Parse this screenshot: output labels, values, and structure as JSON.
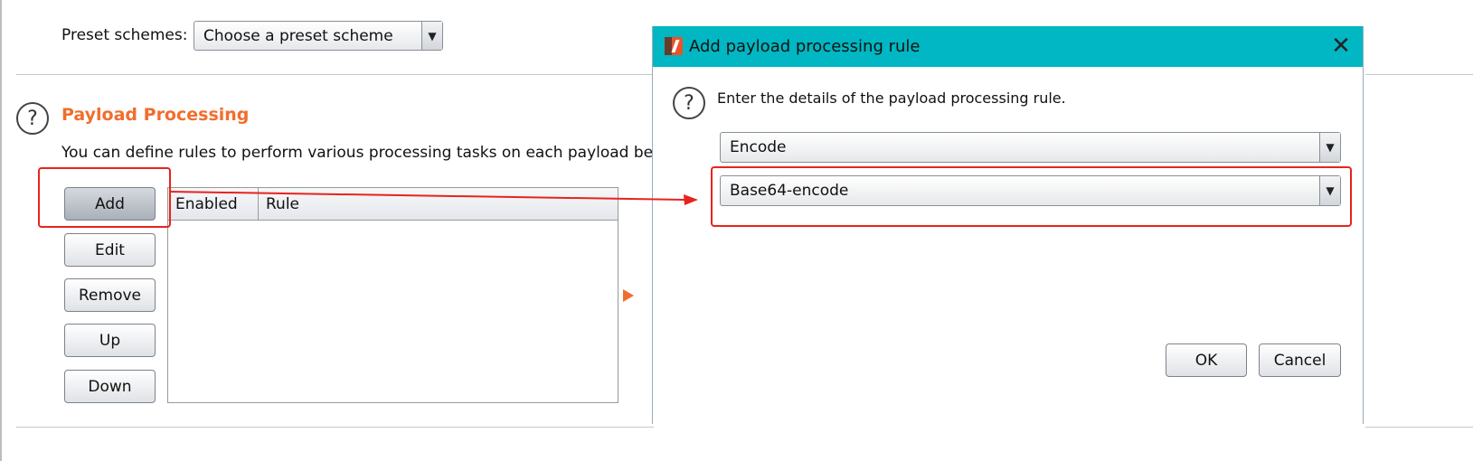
{
  "preset": {
    "label": "Preset schemes:",
    "selected": "Choose a preset scheme"
  },
  "payload_processing": {
    "title": "Payload Processing",
    "description": "You can define rules to perform various processing tasks on each payload before it",
    "buttons": {
      "add": "Add",
      "edit": "Edit",
      "remove": "Remove",
      "up": "Up",
      "down": "Down"
    },
    "table": {
      "columns": [
        "Enabled",
        "Rule"
      ],
      "rows": []
    }
  },
  "dialog": {
    "title": "Add payload processing rule",
    "instruction": "Enter the details of the payload processing rule.",
    "rule_type_selected": "Encode",
    "encoding_selected": "Base64-encode",
    "ok_label": "OK",
    "cancel_label": "Cancel"
  },
  "colors": {
    "accent_orange": "#f26d2d",
    "titlebar_teal": "#00b7c3",
    "annotation_red": "#e8231e"
  },
  "icons": {
    "help": "help-circle-icon",
    "dropdown": "chevron-down-icon",
    "close": "close-icon",
    "app": "burp-suite-icon",
    "expand": "triangle-right-icon"
  }
}
